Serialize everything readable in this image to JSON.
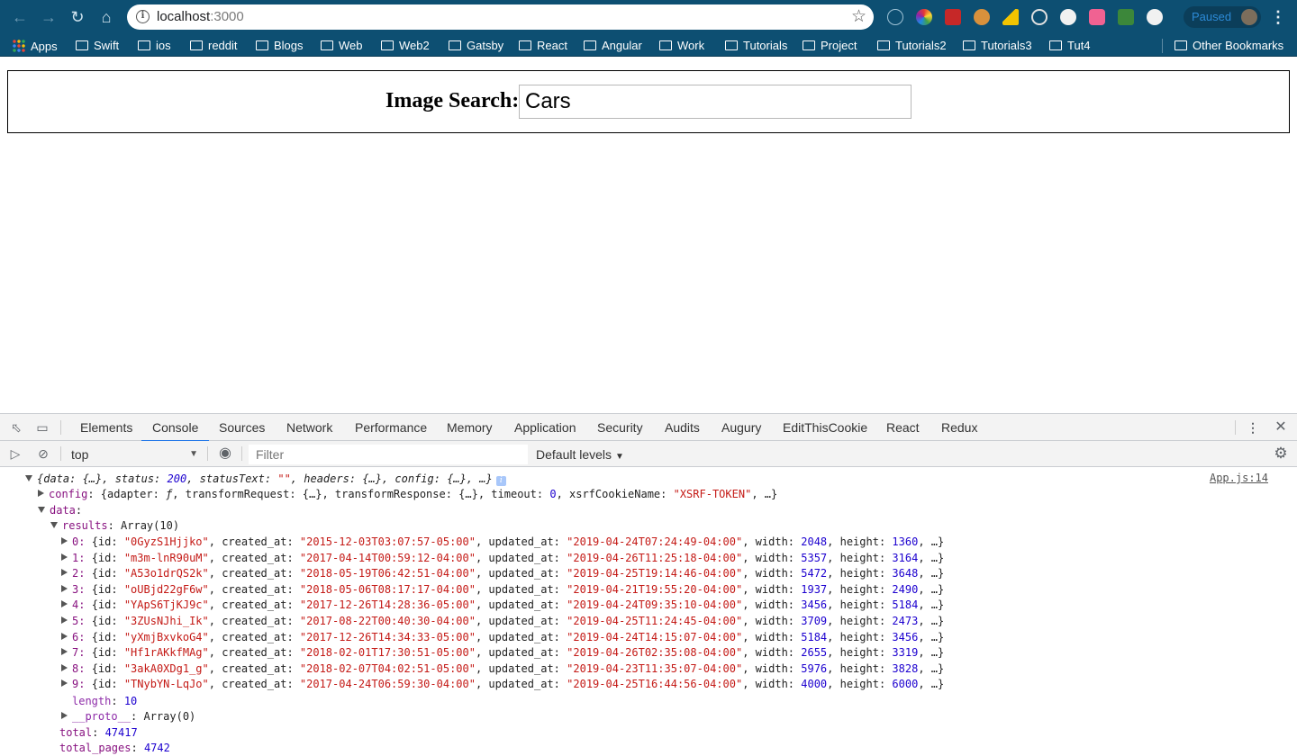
{
  "browser": {
    "url_host": "localhost",
    "url_port": ":3000",
    "paused_label": "Paused",
    "bookmarks": [
      "Apps",
      "Swift",
      "ios",
      "reddit",
      "Blogs",
      "Web",
      "Web2",
      "Gatsby",
      "React",
      "Angular",
      "Work",
      "Tutorials",
      "Project",
      "Tutorials2",
      "Tutorials3",
      "Tut4"
    ],
    "other_bookmarks": "Other Bookmarks"
  },
  "page": {
    "search_label": "Image Search:",
    "search_value": "Cars"
  },
  "devtools": {
    "tabs": [
      "Elements",
      "Console",
      "Sources",
      "Network",
      "Performance",
      "Memory",
      "Application",
      "Security",
      "Audits",
      "Augury",
      "EditThisCookie",
      "React",
      "Redux"
    ],
    "active_tab": "Console",
    "context": "top",
    "filter_placeholder": "Filter",
    "levels": "Default levels",
    "source_link": "App.js:14",
    "console": {
      "summary_status": "200",
      "config_timeout": "0",
      "config_xsrf": "\"XSRF-TOKEN\"",
      "results_label": "Array(10)",
      "results": [
        {
          "idx": "0",
          "id": "\"0GyzS1Hjjko\"",
          "created_at": "\"2015-12-03T03:07:57-05:00\"",
          "updated_at": "\"2019-04-24T07:24:49-04:00\"",
          "width": "2048",
          "height": "1360"
        },
        {
          "idx": "1",
          "id": "\"m3m-lnR90uM\"",
          "created_at": "\"2017-04-14T00:59:12-04:00\"",
          "updated_at": "\"2019-04-26T11:25:18-04:00\"",
          "width": "5357",
          "height": "3164"
        },
        {
          "idx": "2",
          "id": "\"A53o1drQS2k\"",
          "created_at": "\"2018-05-19T06:42:51-04:00\"",
          "updated_at": "\"2019-04-25T19:14:46-04:00\"",
          "width": "5472",
          "height": "3648"
        },
        {
          "idx": "3",
          "id": "\"oUBjd22gF6w\"",
          "created_at": "\"2018-05-06T08:17:17-04:00\"",
          "updated_at": "\"2019-04-21T19:55:20-04:00\"",
          "width": "1937",
          "height": "2490"
        },
        {
          "idx": "4",
          "id": "\"YApS6TjKJ9c\"",
          "created_at": "\"2017-12-26T14:28:36-05:00\"",
          "updated_at": "\"2019-04-24T09:35:10-04:00\"",
          "width": "3456",
          "height": "5184"
        },
        {
          "idx": "5",
          "id": "\"3ZUsNJhi_Ik\"",
          "created_at": "\"2017-08-22T00:40:30-04:00\"",
          "updated_at": "\"2019-04-25T11:24:45-04:00\"",
          "width": "3709",
          "height": "2473"
        },
        {
          "idx": "6",
          "id": "\"yXmjBxvkoG4\"",
          "created_at": "\"2017-12-26T14:34:33-05:00\"",
          "updated_at": "\"2019-04-24T14:15:07-04:00\"",
          "width": "5184",
          "height": "3456"
        },
        {
          "idx": "7",
          "id": "\"Hf1rAKkfMAg\"",
          "created_at": "\"2018-02-01T17:30:51-05:00\"",
          "updated_at": "\"2019-04-26T02:35:08-04:00\"",
          "width": "2655",
          "height": "3319"
        },
        {
          "idx": "8",
          "id": "\"3akA0XDg1_g\"",
          "created_at": "\"2018-02-07T04:02:51-05:00\"",
          "updated_at": "\"2019-04-23T11:35:07-04:00\"",
          "width": "5976",
          "height": "3828"
        },
        {
          "idx": "9",
          "id": "\"TNybYN-LqJo\"",
          "created_at": "\"2017-04-24T06:59:30-04:00\"",
          "updated_at": "\"2019-04-25T16:44:56-04:00\"",
          "width": "4000",
          "height": "6000"
        }
      ],
      "length": "10",
      "proto": "Array(0)",
      "total": "47417",
      "total_pages": "4742"
    }
  }
}
